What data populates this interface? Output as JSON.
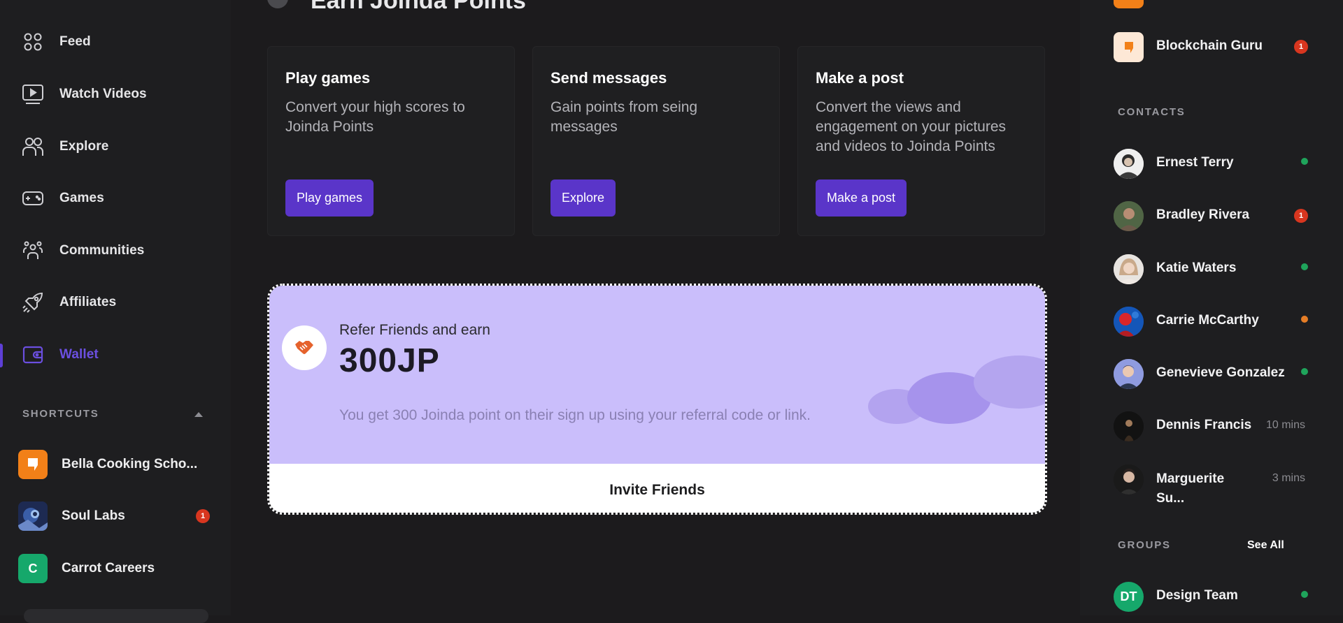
{
  "main": {
    "title": "Earn Joinda Points",
    "cards": [
      {
        "title": "Play games",
        "desc": "Convert your high scores to Joinda Points",
        "button": "Play games"
      },
      {
        "title": "Send messages",
        "desc": "Gain points from seing messages",
        "button": "Explore"
      },
      {
        "title": "Make a post",
        "desc": "Convert the views and engagement on your pictures and videos to Joinda Points",
        "button": "Make a post"
      }
    ],
    "referral": {
      "subtitle": "Refer Friends and earn",
      "amount": "300JP",
      "description": "You get 300 Joinda point on their sign up using your referral code or link.",
      "button": "Invite Friends",
      "icon": "handshake-icon"
    }
  },
  "sidebar": {
    "nav": [
      {
        "label": "Feed",
        "icon": "grid-icon"
      },
      {
        "label": "Watch Videos",
        "icon": "video-icon"
      },
      {
        "label": "Explore",
        "icon": "people-icon"
      },
      {
        "label": "Games",
        "icon": "gamepad-icon"
      },
      {
        "label": "Communities",
        "icon": "community-icon"
      },
      {
        "label": "Affiliates",
        "icon": "rocket-icon"
      },
      {
        "label": "Wallet",
        "icon": "wallet-icon",
        "active": true
      }
    ],
    "shortcuts_title": "SHORTCUTS",
    "shortcuts": [
      {
        "label": "Bella Cooking Scho...",
        "badge": ""
      },
      {
        "label": "Soul Labs",
        "badge": "1"
      },
      {
        "label": "Carrot Careers",
        "initial": "C",
        "badge": ""
      }
    ]
  },
  "right": {
    "top_item": {
      "name": "Blockchain Guru",
      "badge": "1"
    },
    "contacts_title": "CONTACTS",
    "contacts": [
      {
        "name": "Ernest Terry",
        "status": "online"
      },
      {
        "name": "Bradley Rivera",
        "badge": "1"
      },
      {
        "name": "Katie Waters",
        "status": "online"
      },
      {
        "name": "Carrie McCarthy",
        "status": "away"
      },
      {
        "name": "Genevieve Gonzalez",
        "status": "online"
      },
      {
        "name": "Dennis Francis",
        "time": "10 mins"
      },
      {
        "name_line1": "Marguerite",
        "name_line2": "Su...",
        "time": "3 mins"
      }
    ],
    "groups_title": "GROUPS",
    "see_all": "See All",
    "groups": [
      {
        "name": "Design Team",
        "initials": "DT",
        "status": "online"
      }
    ]
  },
  "colors": {
    "accent": "#5a35c9",
    "referral_bg": "#cabefb",
    "badge": "#d8361f",
    "online": "#1fa45b",
    "away": "#e57d26"
  }
}
